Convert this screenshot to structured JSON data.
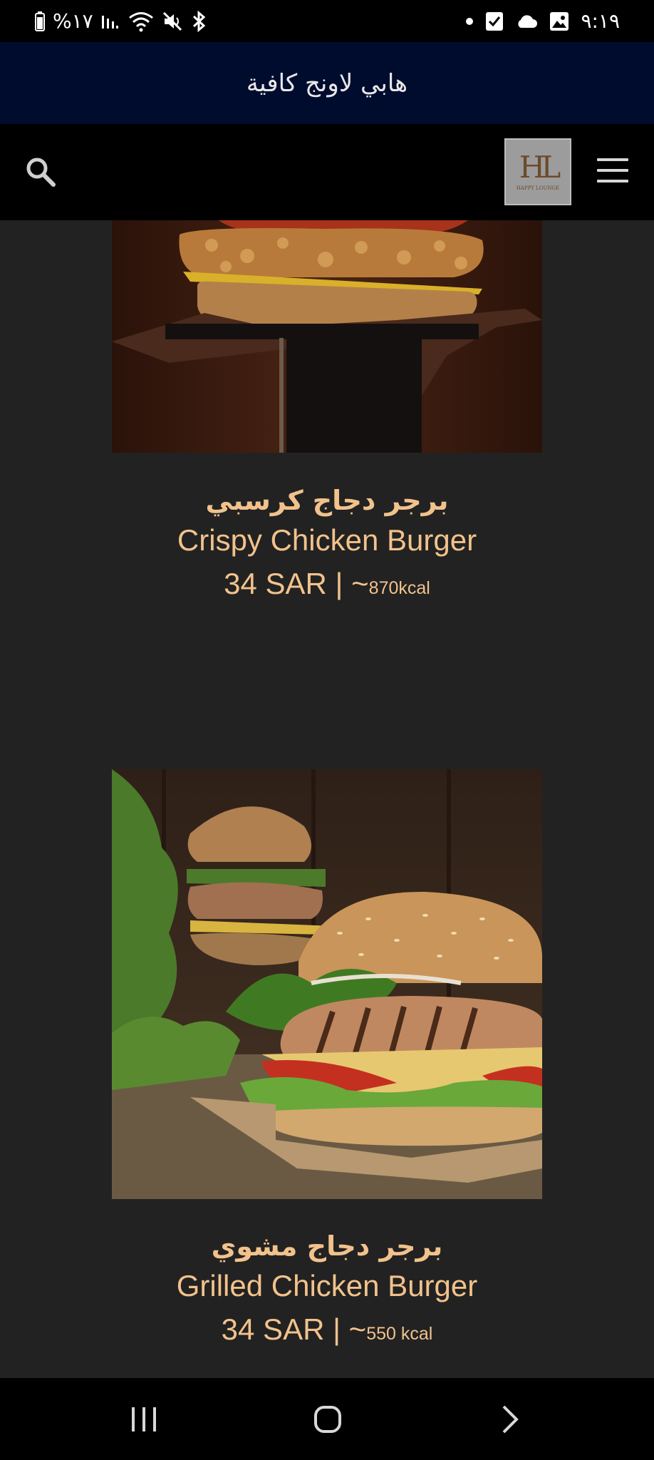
{
  "status_bar": {
    "battery_text": "%١٧",
    "time": "٩:١٩",
    "icons_left": [
      "battery-icon",
      "signal-icon",
      "wifi-icon",
      "mute-icon",
      "bluetooth-icon"
    ],
    "icons_right": [
      "dot-icon",
      "checkbox-notification-icon",
      "cloud-icon",
      "image-icon"
    ]
  },
  "title_bar": {
    "title": "هابي لاونج كافية"
  },
  "header": {
    "search_icon": "search-icon",
    "logo_mark": "HL",
    "logo_sub": "HAPPY LOUNGE",
    "menu_icon": "hamburger-menu-icon"
  },
  "products": [
    {
      "name_ar": "برجر دجاج كرسبي",
      "name_en": "Crispy Chicken Burger",
      "price": "34 SAR | ~",
      "kcal": "870kcal"
    },
    {
      "name_ar": "برجر دجاج مشوي",
      "name_en": "Grilled Chicken Burger",
      "price": "34 SAR | ~",
      "kcal": "550 kcal"
    }
  ],
  "nav_bar": {
    "recents_icon": "recents-icon",
    "home_icon": "home-icon",
    "back_icon": "back-icon"
  },
  "colors": {
    "title_bar_bg": "#000c2e",
    "page_bg": "#222222",
    "accent_text": "#f2c28c"
  }
}
